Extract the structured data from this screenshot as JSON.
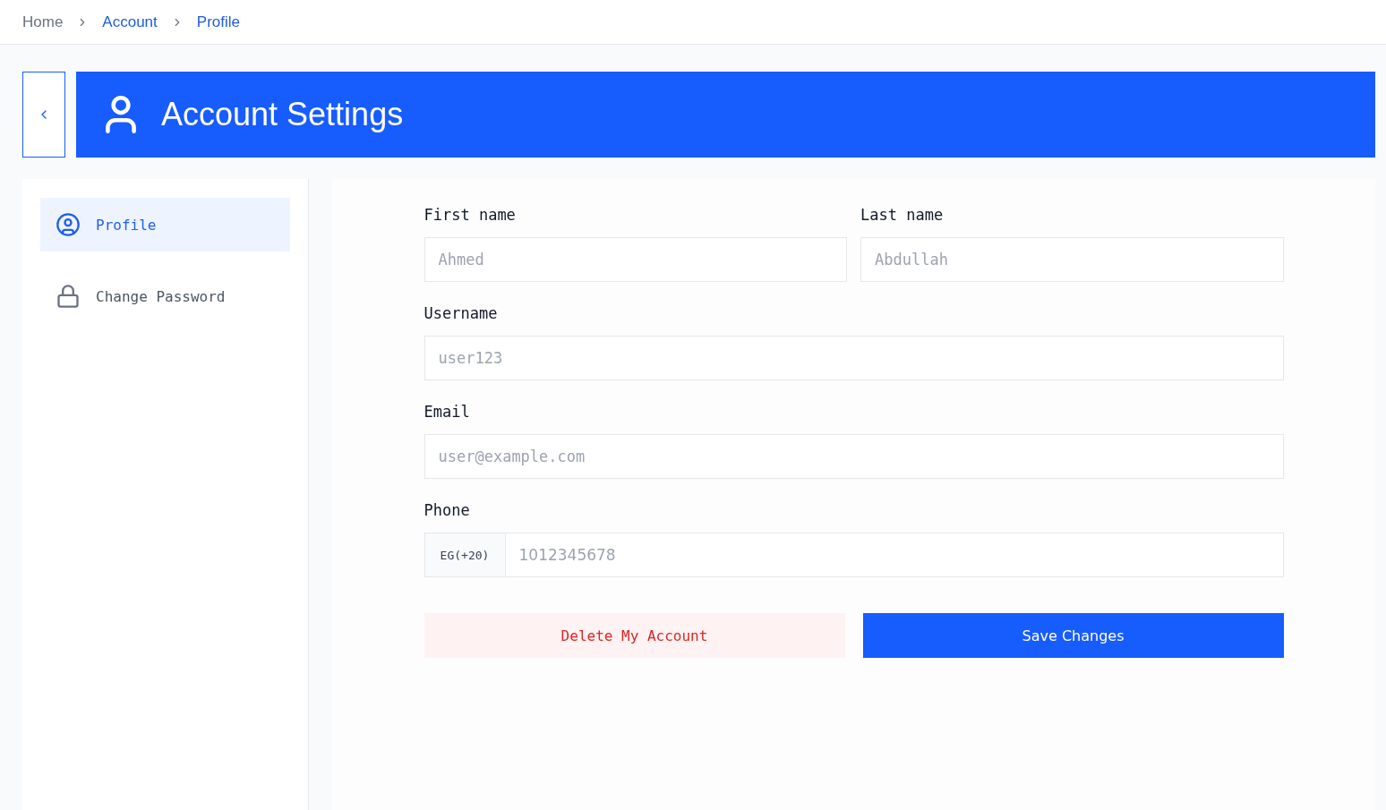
{
  "breadcrumb": [
    {
      "label": "Home",
      "muted": true
    },
    {
      "label": "Account",
      "muted": false
    },
    {
      "label": "Profile",
      "muted": false
    }
  ],
  "header": {
    "title": "Account Settings"
  },
  "sidebar": {
    "items": [
      {
        "label": "Profile",
        "selected": true
      },
      {
        "label": "Change Password",
        "selected": false
      }
    ]
  },
  "form": {
    "fields": [
      {
        "kind": "half",
        "label": "First name",
        "placeholder": "Ahmed"
      },
      {
        "kind": "half",
        "label": "Last name",
        "placeholder": "Abdullah"
      },
      {
        "kind": "full",
        "label": "Username",
        "placeholder": "user123"
      },
      {
        "kind": "full",
        "label": "Email",
        "placeholder": "user@example.com"
      },
      {
        "kind": "phone",
        "label": "Phone",
        "prefix": "EG(+20)",
        "placeholder": "1012345678"
      }
    ],
    "actions": [
      {
        "kind": "danger",
        "label": "Delete My Account"
      },
      {
        "kind": "primary",
        "label": "Save Changes"
      }
    ]
  }
}
